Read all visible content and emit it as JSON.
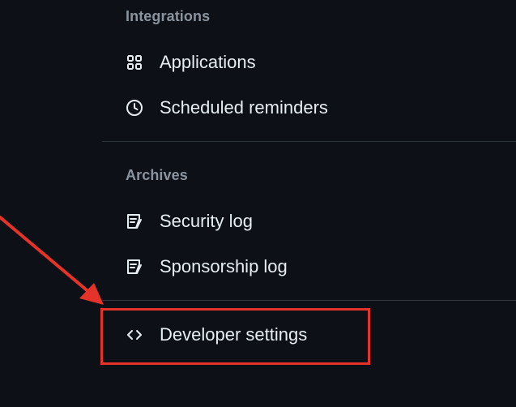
{
  "integrations": {
    "heading": "Integrations",
    "items": [
      {
        "label": "Applications",
        "icon": "apps-icon"
      },
      {
        "label": "Scheduled reminders",
        "icon": "clock-icon"
      }
    ]
  },
  "archives": {
    "heading": "Archives",
    "items": [
      {
        "label": "Security log",
        "icon": "log-icon"
      },
      {
        "label": "Sponsorship log",
        "icon": "log-icon"
      }
    ]
  },
  "developer": {
    "label": "Developer settings",
    "icon": "code-icon"
  },
  "annotation": {
    "color": "#e5332a"
  },
  "colors": {
    "background": "#0d1117",
    "text": "#e6edf3",
    "muted": "#8b949e",
    "divider": "#30363d"
  }
}
